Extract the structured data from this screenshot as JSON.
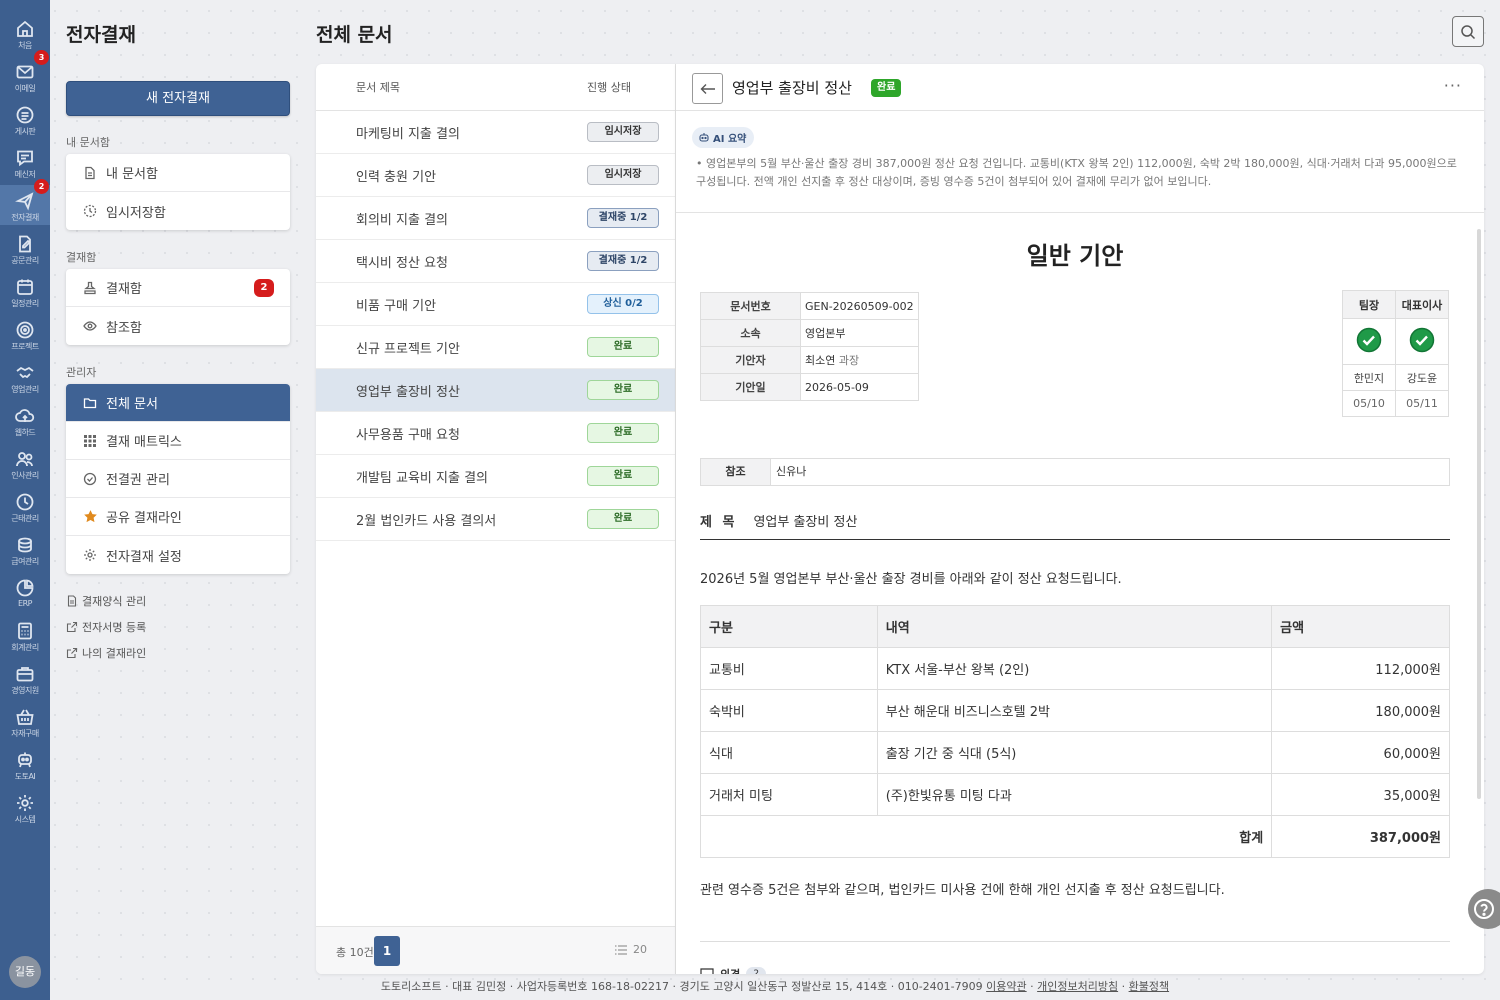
{
  "rail": {
    "items": [
      {
        "label": "처음",
        "icon": "home-icon"
      },
      {
        "label": "이메일",
        "icon": "mail-icon",
        "badge": "3"
      },
      {
        "label": "게시판",
        "icon": "board-icon"
      },
      {
        "label": "메신저",
        "icon": "messenger-icon"
      },
      {
        "label": "전자결재",
        "icon": "approval-icon",
        "badge": "2"
      },
      {
        "label": "공문관리",
        "icon": "document-edit-icon"
      },
      {
        "label": "일정관리",
        "icon": "calendar-icon"
      },
      {
        "label": "프로젝트",
        "icon": "target-icon"
      },
      {
        "label": "영업관리",
        "icon": "handshake-icon"
      },
      {
        "label": "웹하드",
        "icon": "cloud-icon"
      },
      {
        "label": "인사관리",
        "icon": "people-icon"
      },
      {
        "label": "근태관리",
        "icon": "clock-icon"
      },
      {
        "label": "급여관리",
        "icon": "coins-icon"
      },
      {
        "label": "ERP",
        "icon": "pie-chart-icon"
      },
      {
        "label": "회계관리",
        "icon": "calculator-icon"
      },
      {
        "label": "경영지원",
        "icon": "briefcase-icon"
      },
      {
        "label": "자재구매",
        "icon": "basket-icon"
      },
      {
        "label": "도토AI",
        "icon": "robot-icon"
      },
      {
        "label": "시스템",
        "icon": "gear-icon"
      }
    ],
    "avatar": "길동"
  },
  "sidebar": {
    "title": "전자결재",
    "new_button": "새 전자결재",
    "my_docs_label": "내 문서함",
    "my_docs": [
      {
        "label": "내 문서함",
        "icon": "document-icon"
      },
      {
        "label": "임시저장함",
        "icon": "clock-dashed-icon"
      }
    ],
    "approval_label": "결재함",
    "approval": [
      {
        "label": "결재함",
        "icon": "stamp-icon",
        "count": "2"
      },
      {
        "label": "참조함",
        "icon": "eye-icon"
      }
    ],
    "admin_label": "관리자",
    "admin": [
      {
        "label": "전체 문서",
        "icon": "folder-icon"
      },
      {
        "label": "결재 매트릭스",
        "icon": "grid-icon"
      },
      {
        "label": "전결권 관리",
        "icon": "check-circle-icon"
      },
      {
        "label": "공유 결재라인",
        "icon": "star-icon"
      },
      {
        "label": "전자결재 설정",
        "icon": "gear-icon"
      }
    ],
    "links": [
      {
        "label": "결재양식 관리",
        "icon": "form-icon"
      },
      {
        "label": "전자서명 등록",
        "icon": "external-link-icon"
      },
      {
        "label": "나의 결재라인",
        "icon": "external-link-icon"
      }
    ]
  },
  "page": {
    "title": "전체 문서"
  },
  "list": {
    "col_title": "문서 제목",
    "col_status": "진행 상태",
    "rows": [
      {
        "title": "마케팅비 지출 결의",
        "status": "임시저장",
        "kind": "temp"
      },
      {
        "title": "인력 충원 기안",
        "status": "임시저장",
        "kind": "temp"
      },
      {
        "title": "회의비 지출 결의",
        "status": "결재중 1/2",
        "kind": "prog"
      },
      {
        "title": "택시비 정산 요청",
        "status": "결재중 1/2",
        "kind": "prog"
      },
      {
        "title": "비품 구매 기안",
        "status": "상신 0/2",
        "kind": "up"
      },
      {
        "title": "신규 프로젝트 기안",
        "status": "완료",
        "kind": "done"
      },
      {
        "title": "영업부 출장비 정산",
        "status": "완료",
        "kind": "done"
      },
      {
        "title": "사무용품 구매 요청",
        "status": "완료",
        "kind": "done"
      },
      {
        "title": "개발팀 교육비 지출 결의",
        "status": "완료",
        "kind": "done"
      },
      {
        "title": "2월 법인카드 사용 결의서",
        "status": "완료",
        "kind": "done"
      }
    ],
    "total": "총 10건",
    "page": "1",
    "per_page": "20"
  },
  "detail": {
    "title": "영업부 출장비 정산",
    "badge": "완료",
    "ai_label": "AI 요약",
    "ai_text": "• 영업본부의 5월 부산·울산 출장 경비 387,000원 정산 요청 건입니다. 교통비(KTX 왕복 2인) 112,000원, 숙박 2박 180,000원, 식대·거래처 다과 95,000원으로 구성됩니다. 전액 개인 선지출 후 정산 대상이며, 증빙 영수증 5건이 첨부되어 있어 결재에 무리가 없어 보입니다.",
    "doc_title": "일반 기안",
    "meta": [
      {
        "k": "문서번호",
        "v": "GEN-20260509-002"
      },
      {
        "k": "소속",
        "v": "영업본부"
      },
      {
        "k": "기안자",
        "v": "최소연",
        "v2": "과장"
      },
      {
        "k": "기안일",
        "v": "2026-05-09"
      }
    ],
    "signers": [
      {
        "role": "팀장",
        "name": "한민지",
        "date": "05/10"
      },
      {
        "role": "대표이사",
        "name": "강도윤",
        "date": "05/11"
      }
    ],
    "ref_label": "참조",
    "ref_value": "신유나",
    "subject_label": "제 목",
    "subject_value": "영업부 출장비 정산",
    "intro": "2026년 5월 영업본부 부산·울산 출장 경비를 아래와 같이 정산 요청드립니다.",
    "table_head": [
      "구분",
      "내역",
      "금액"
    ],
    "table_rows": [
      [
        "교통비",
        "KTX 서울-부산 왕복 (2인)",
        "112,000원"
      ],
      [
        "숙박비",
        "부산 해운대 비즈니스호텔 2박",
        "180,000원"
      ],
      [
        "식대",
        "출장 기간 중 식대 (5식)",
        "60,000원"
      ],
      [
        "거래처 미팅",
        "(주)한빛유통 미팅 다과",
        "35,000원"
      ]
    ],
    "total_label": "합계",
    "total_value": "387,000원",
    "closing": "관련 영수증 5건은 첨부와 같으며, 법인카드 미사용 건에 한해 개인 선지출 후 정산 요청드립니다.",
    "opinion_label": "의견",
    "opinion_count": "2"
  },
  "footer": {
    "company": "도토리소프트 · 대표 김민정 · 사업자등록번호 168-18-02217 · 경기도 고양시 일산동구 정발산로 15, 414호 · 010-2401-7909",
    "terms": "이용약관",
    "privacy": "개인정보처리방침",
    "refund": "환불정책"
  }
}
